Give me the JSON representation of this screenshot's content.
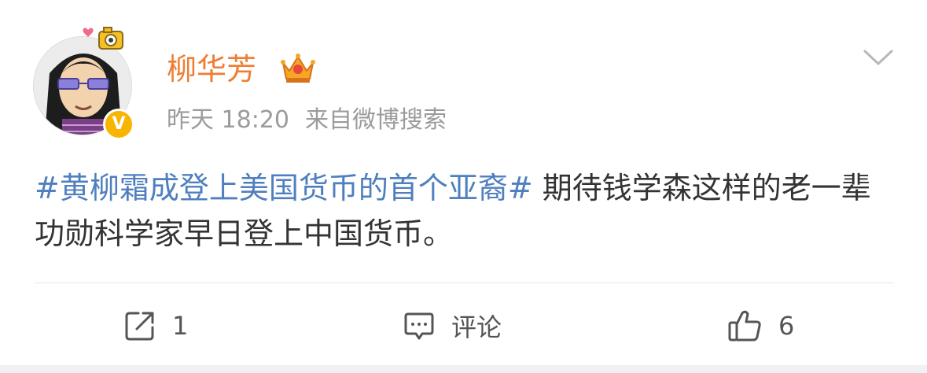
{
  "post": {
    "author": {
      "name": "柳华芳",
      "verified_icon": "verified-v-badge",
      "member_icon": "crown-icon"
    },
    "timestamp": "昨天 18:20",
    "source": "来自微博搜索",
    "content": {
      "hashtag": "#黄柳霜成登上美国货币的首个亚裔#",
      "text": " 期待钱学森这样的老一辈功勋科学家早日登上中国货币。"
    },
    "actions": {
      "repost": {
        "icon": "share-icon",
        "count": "1"
      },
      "comment": {
        "icon": "comment-icon",
        "label": "评论"
      },
      "like": {
        "icon": "thumbs-up-icon",
        "count": "6"
      }
    }
  },
  "colors": {
    "username": "#ef7d32",
    "hashtag": "#4f7fbf",
    "meta": "#9b9b9b",
    "body_text": "#333333",
    "verified_badge": "#f7b500"
  }
}
